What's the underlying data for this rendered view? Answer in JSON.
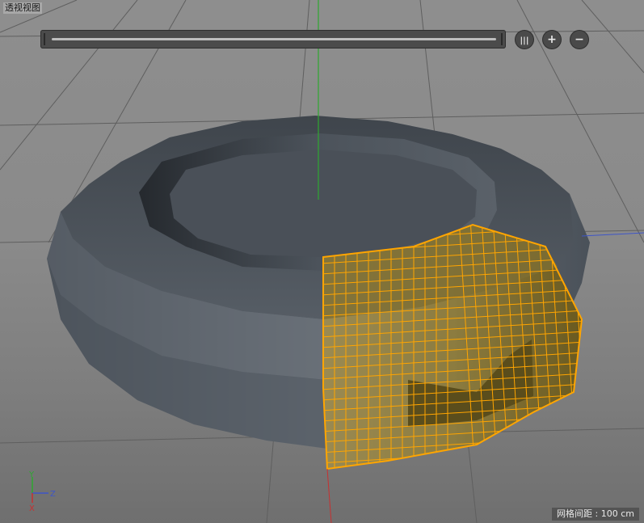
{
  "viewport": {
    "title": "透视视图",
    "grid_spacing": "网格间距 : 100 cm",
    "axes": {
      "y": "Y",
      "z": "Z",
      "x": "X"
    }
  },
  "nav_controls": {
    "buttons": [
      {
        "name": "nav-layout-button",
        "icon": "columns-icon",
        "label": "|||"
      },
      {
        "name": "nav-zoom-in-button",
        "icon": "plus-icon",
        "label": "+"
      },
      {
        "name": "nav-zoom-out-button",
        "icon": "minus-icon",
        "label": "−"
      }
    ]
  },
  "colors": {
    "selection": "#ffa500",
    "model": "#4c535b",
    "axis_x": "#c83030",
    "axis_y": "#2ea830",
    "axis_z": "#3e55c8"
  }
}
